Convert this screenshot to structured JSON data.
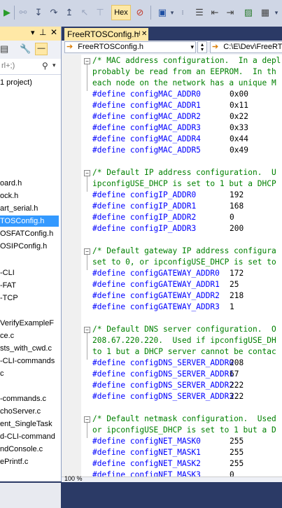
{
  "toolbar": {
    "hex_label": "Hex"
  },
  "left_panel": {
    "search_partial": "rl+;)",
    "items": [
      {
        "label": "1 project)",
        "top": 0
      },
      {
        "label": "oard.h"
      },
      {
        "label": "ock.h"
      },
      {
        "label": "art_serial.h"
      },
      {
        "label": "TOSConfig.h"
      },
      {
        "label": "OSFATConfig.h"
      },
      {
        "label": "OSIPConfig.h"
      },
      {
        "label": "-CLI"
      },
      {
        "label": "-FAT"
      },
      {
        "label": "-TCP"
      },
      {
        "label": "VerifyExampleF"
      },
      {
        "label": "ce.c"
      },
      {
        "label": "sts_with_cwd.c"
      },
      {
        "label": "-CLI-commands"
      },
      {
        "label": "c"
      },
      {
        "label": "-commands.c"
      },
      {
        "label": "choServer.c"
      },
      {
        "label": "ent_SingleTask"
      },
      {
        "label": "d-CLI-command"
      },
      {
        "label": "ndConsole.c"
      },
      {
        "label": "ePrintf.c"
      }
    ]
  },
  "editor": {
    "tab_label": "FreeRTOSConfig.h",
    "nav_file": "FreeRTOSConfig.h",
    "nav_path": "C:\\E\\Dev\\FreeRTOS",
    "zoom": "100 %",
    "lines": [
      {
        "t": "/* MAC address configuration.  In a depl",
        "c": "cm"
      },
      {
        "t": "probably be read from an EEPROM.  In th",
        "c": "cm"
      },
      {
        "t": "each node on the network has a unique M",
        "c": "cm"
      },
      {
        "t": "#define configMAC_ADDR0",
        "v": "0x00"
      },
      {
        "t": "#define configMAC_ADDR1",
        "v": "0x11"
      },
      {
        "t": "#define configMAC_ADDR2",
        "v": "0x22"
      },
      {
        "t": "#define configMAC_ADDR3",
        "v": "0x33"
      },
      {
        "t": "#define configMAC_ADDR4",
        "v": "0x44"
      },
      {
        "t": "#define configMAC_ADDR5",
        "v": "0x49"
      },
      {
        "t": "",
        "c": "nm"
      },
      {
        "t": "/* Default IP address configuration.  U",
        "c": "cm"
      },
      {
        "t": "ipconfigUSE_DHCP is set to 1 but a DHCP",
        "c": "cm"
      },
      {
        "t": "#define configIP_ADDR0",
        "v": "192"
      },
      {
        "t": "#define configIP_ADDR1",
        "v": "168"
      },
      {
        "t": "#define configIP_ADDR2",
        "v": "0"
      },
      {
        "t": "#define configIP_ADDR3",
        "v": "200"
      },
      {
        "t": "",
        "c": "nm"
      },
      {
        "t": "/* Default gateway IP address configura",
        "c": "cm"
      },
      {
        "t": "set to 0, or ipconfigUSE_DHCP is set to",
        "c": "cm"
      },
      {
        "t": "#define configGATEWAY_ADDR0",
        "v": "172"
      },
      {
        "t": "#define configGATEWAY_ADDR1",
        "v": "25"
      },
      {
        "t": "#define configGATEWAY_ADDR2",
        "v": "218"
      },
      {
        "t": "#define configGATEWAY_ADDR3",
        "v": "1"
      },
      {
        "t": "",
        "c": "nm"
      },
      {
        "t": "/* Default DNS server configuration.  O",
        "c": "cm"
      },
      {
        "t": "208.67.220.220.  Used if ipconfigUSE_DH",
        "c": "cm"
      },
      {
        "t": "to 1 but a DHCP server cannot be contac",
        "c": "cm"
      },
      {
        "t": "#define configDNS_SERVER_ADDR0",
        "v": "208"
      },
      {
        "t": "#define configDNS_SERVER_ADDR1",
        "v": "67"
      },
      {
        "t": "#define configDNS_SERVER_ADDR2",
        "v": "222"
      },
      {
        "t": "#define configDNS_SERVER_ADDR3",
        "v": "222"
      },
      {
        "t": "",
        "c": "nm"
      },
      {
        "t": "/* Default netmask configuration.  Used",
        "c": "cm"
      },
      {
        "t": "or ipconfigUSE_DHCP is set to 1 but a D",
        "c": "cm"
      },
      {
        "t": "#define configNET_MASK0",
        "v": "255"
      },
      {
        "t": "#define configNET_MASK1",
        "v": "255"
      },
      {
        "t": "#define configNET_MASK2",
        "v": "255"
      },
      {
        "t": "#define configNET_MASK3",
        "v": "0"
      }
    ]
  }
}
